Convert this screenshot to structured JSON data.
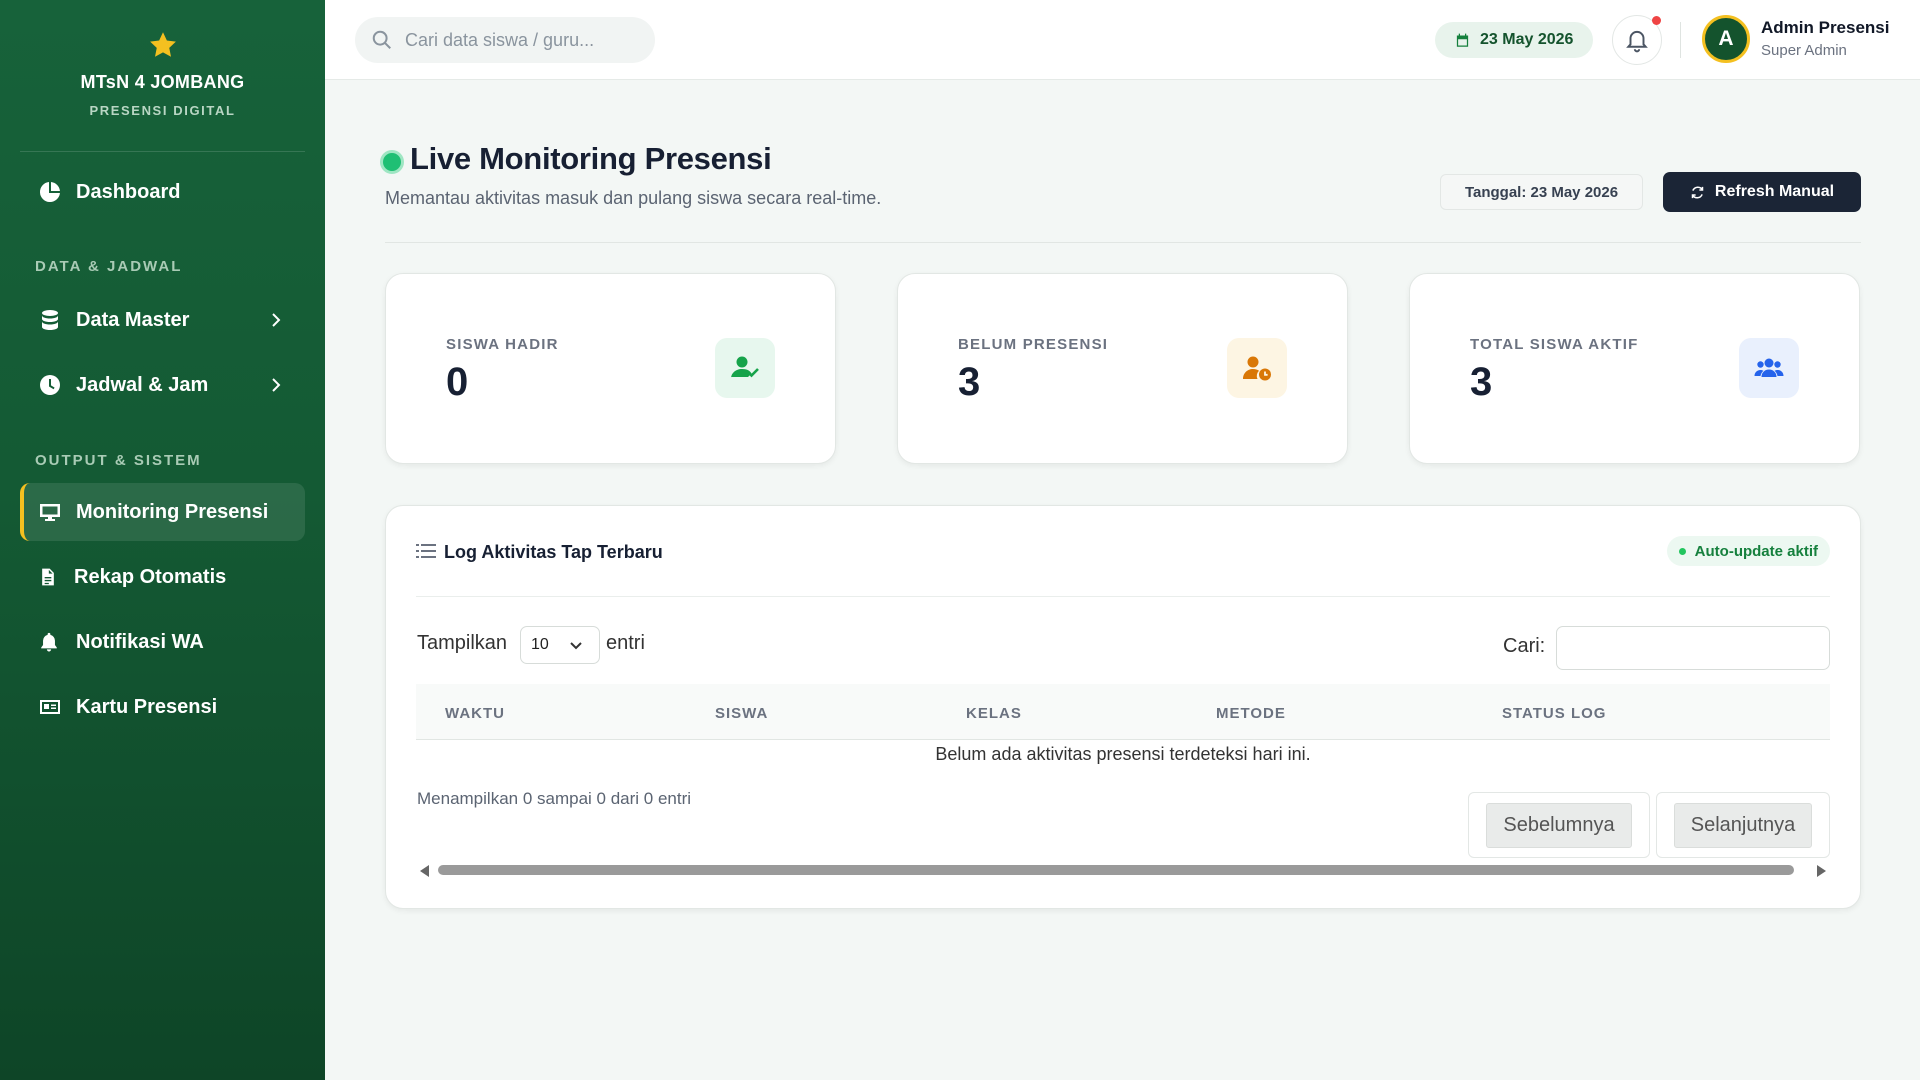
{
  "colors": {
    "sidebar": "#17623a",
    "accent": "#f4c020",
    "primary_dark": "#1b2536",
    "success": "#22c55e"
  },
  "brand": {
    "name": "MTsN 4 JOMBANG",
    "subtitle": "PRESENSI DIGITAL",
    "icon": "star-icon"
  },
  "sidebar": {
    "dashboard": {
      "label": "Dashboard",
      "icon": "chart-pie-icon"
    },
    "section_data": "DATA & JADWAL",
    "data_master": {
      "label": "Data Master",
      "icon": "database-icon"
    },
    "jadwal": {
      "label": "Jadwal & Jam",
      "icon": "clock-icon"
    },
    "section_output": "OUTPUT & SISTEM",
    "monitoring": {
      "label": "Monitoring Presensi",
      "icon": "desktop-icon",
      "active": true
    },
    "rekap": {
      "label": "Rekap Otomatis",
      "icon": "file-icon"
    },
    "notifikasi": {
      "label": "Notifikasi WA",
      "icon": "bell-icon"
    },
    "kartu": {
      "label": "Kartu Presensi",
      "icon": "id-card-icon"
    }
  },
  "topbar": {
    "search_placeholder": "Cari data siswa / guru...",
    "date": "23 May 2026",
    "avatar_letter": "A",
    "user_name": "Admin Presensi",
    "user_role": "Super Admin"
  },
  "page": {
    "title": "Live Monitoring Presensi",
    "subtitle": "Memantau aktivitas masuk dan pulang siswa secara real-time.",
    "date_label": "Tanggal: 23 May 2026",
    "refresh_label": "Refresh Manual"
  },
  "stats": [
    {
      "label": "SISWA HADIR",
      "value": "0",
      "icon": "user-check-icon",
      "color": "#16a34a"
    },
    {
      "label": "BELUM PRESENSI",
      "value": "3",
      "icon": "user-clock-icon",
      "color": "#d97706"
    },
    {
      "label": "TOTAL SISWA AKTIF",
      "value": "3",
      "icon": "users-icon",
      "color": "#2563eb"
    }
  ],
  "log": {
    "title": "Log Aktivitas Tap Terbaru",
    "badge": "Auto-update aktif",
    "show_label": "Tampilkan",
    "show_value": "10",
    "show_after": "entri",
    "search_label": "Cari:",
    "columns": [
      "WAKTU",
      "SISWA",
      "KELAS",
      "METODE",
      "STATUS LOG"
    ],
    "empty": "Belum ada aktivitas presensi terdeteksi hari ini.",
    "info": "Menampilkan 0 sampai 0 dari 0 entri",
    "prev": "Sebelumnya",
    "next": "Selanjutnya"
  }
}
